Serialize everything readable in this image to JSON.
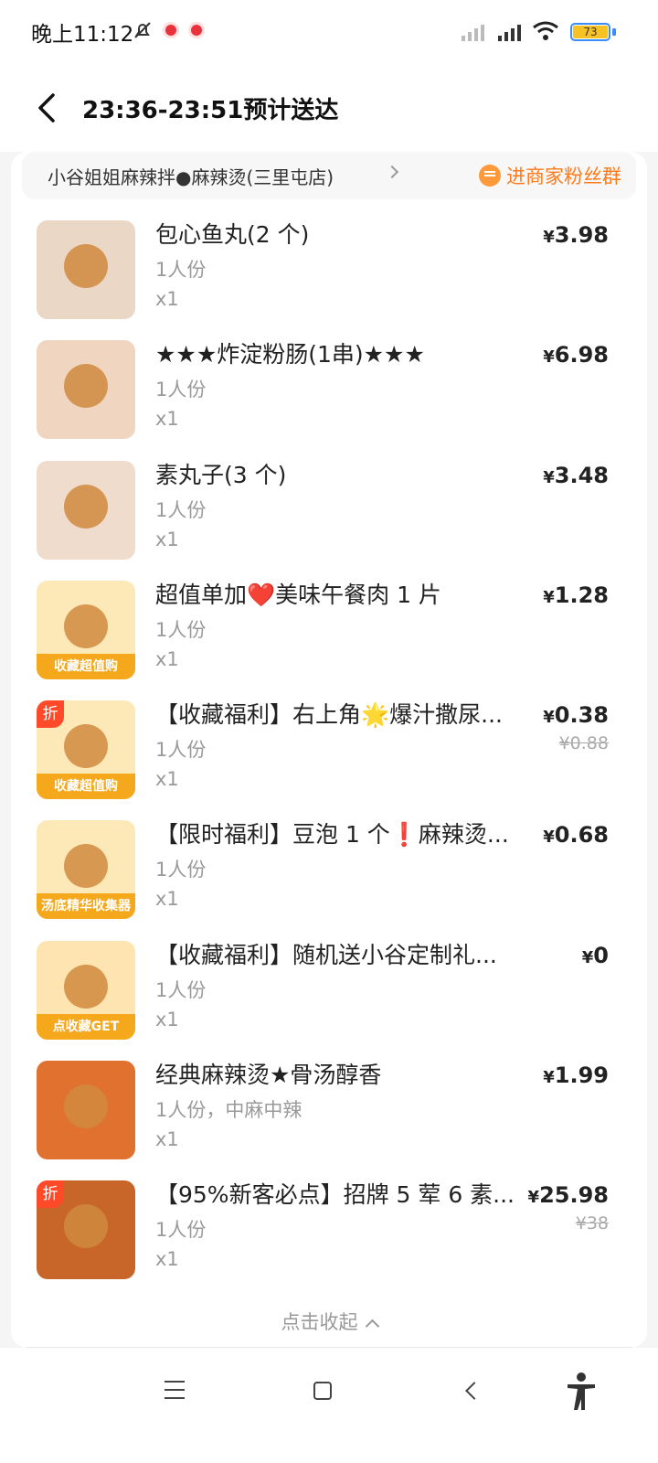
{
  "status_bar": {
    "time": "晚上11:12",
    "battery": "73"
  },
  "header": {
    "title": "23:36-23:51预计送达"
  },
  "store": {
    "name": "小谷姐姐麻辣拌●麻辣烫(三里屯店)",
    "fans_label": "进商家粉丝群"
  },
  "items": [
    {
      "name": "包心鱼丸(2 个)",
      "spec": "1人份",
      "qty": "x1",
      "price": "3.98",
      "orig": "",
      "thumb": {
        "bg": "#ead7c5",
        "banner": "",
        "discount": ""
      }
    },
    {
      "name": "★★★炸淀粉肠(1串)★★★",
      "spec": "1人份",
      "qty": "x1",
      "price": "6.98",
      "orig": "",
      "thumb": {
        "bg": "#f0d6c0",
        "banner": "",
        "discount": ""
      }
    },
    {
      "name": "素丸子(3 个)",
      "spec": "1人份",
      "qty": "x1",
      "price": "3.48",
      "orig": "",
      "thumb": {
        "bg": "#efdccc",
        "banner": "",
        "discount": ""
      }
    },
    {
      "name": "超值单加❤️美味午餐肉 1 片",
      "spec": "1人份",
      "qty": "x1",
      "price": "1.28",
      "orig": "",
      "thumb": {
        "bg": "#fde9b8",
        "banner": "收藏超值购",
        "discount": ""
      }
    },
    {
      "name": "【收藏福利】右上角🌟爆汁撒尿...",
      "spec": "1人份",
      "qty": "x1",
      "price": "0.38",
      "orig": "¥0.88",
      "thumb": {
        "bg": "#fde9b8",
        "banner": "收藏超值购",
        "discount": "折"
      }
    },
    {
      "name": "【限时福利】豆泡 1 个❗麻辣烫...",
      "spec": "1人份",
      "qty": "x1",
      "price": "0.68",
      "orig": "",
      "thumb": {
        "bg": "#fde9b8",
        "banner": "汤底精华收集器",
        "discount": ""
      }
    },
    {
      "name": "【收藏福利】随机送小谷定制礼...",
      "spec": "1人份",
      "qty": "x1",
      "price": "0",
      "orig": "",
      "thumb": {
        "bg": "#fde4b0",
        "banner": "点收藏GET",
        "discount": ""
      }
    },
    {
      "name": "经典麻辣烫★骨汤醇香",
      "spec": "1人份，中麻中辣",
      "qty": "x1",
      "price": "1.99",
      "orig": "",
      "thumb": {
        "bg": "#e0712f",
        "banner": "",
        "discount": ""
      }
    },
    {
      "name": "【95%新客必点】招牌 5 荤 6 素...",
      "spec": "1人份",
      "qty": "x1",
      "price": "25.98",
      "orig": "¥38",
      "thumb": {
        "bg": "#c8662a",
        "banner": "",
        "discount": "折"
      }
    }
  ],
  "currency": "¥",
  "collapse_label": "点击收起",
  "icons": {
    "back": "chevron-left-icon",
    "bell_muted": "bell-off-icon",
    "fans_chat": "chat-icon",
    "collapse": "chevron-up-icon"
  }
}
